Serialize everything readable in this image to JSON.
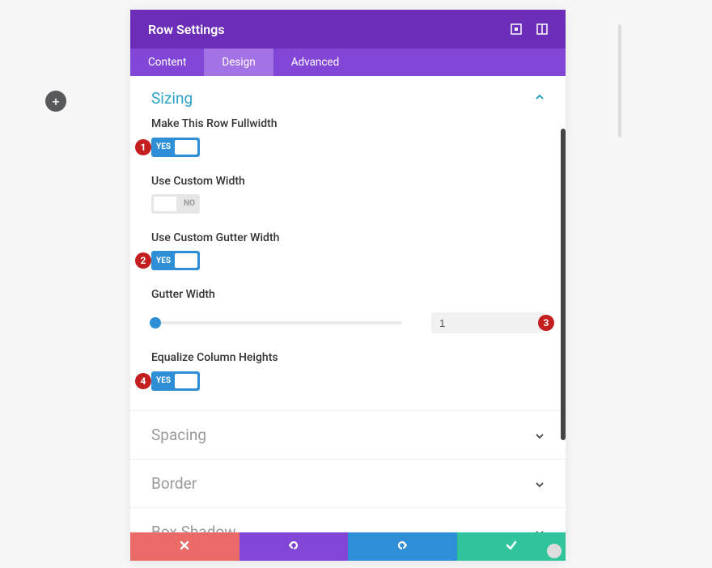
{
  "add_button_tooltip": "Add",
  "modal": {
    "title": "Row Settings",
    "tabs": [
      "Content",
      "Design",
      "Advanced"
    ],
    "activeTab": 1
  },
  "sections": {
    "sizing": {
      "title": "Sizing",
      "open": true
    },
    "spacing": {
      "title": "Spacing"
    },
    "border": {
      "title": "Border"
    },
    "boxshadow": {
      "title": "Box Shadow"
    }
  },
  "fields": {
    "fullwidth": {
      "label": "Make This Row Fullwidth",
      "value": "YES"
    },
    "customWidth": {
      "label": "Use Custom Width",
      "value": "NO"
    },
    "customGutter": {
      "label": "Use Custom Gutter Width",
      "value": "YES"
    },
    "gutterWidth": {
      "label": "Gutter Width",
      "value": "1"
    },
    "equalize": {
      "label": "Equalize Column Heights",
      "value": "YES"
    }
  },
  "badges": {
    "b1": "1",
    "b2": "2",
    "b3": "3",
    "b4": "4"
  }
}
